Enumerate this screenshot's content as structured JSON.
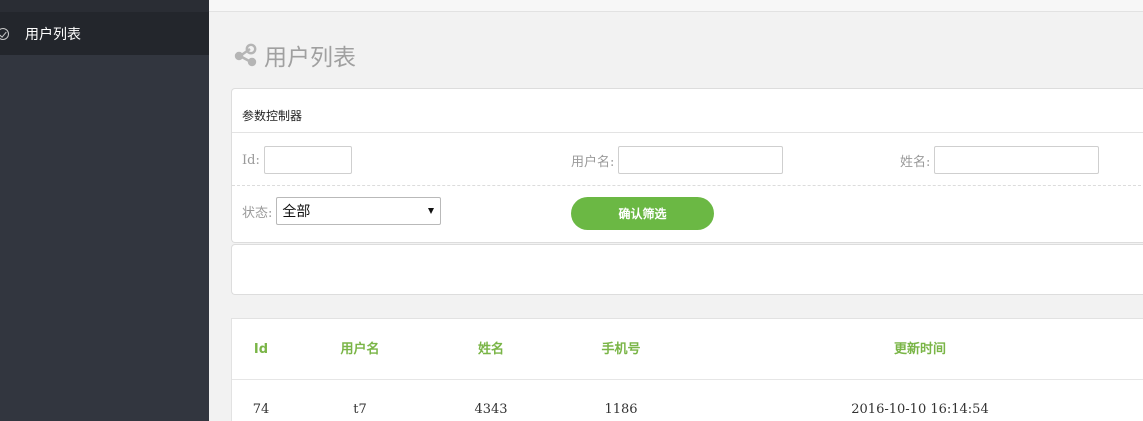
{
  "sidebar": {
    "items": [
      {
        "label": "用户列表",
        "icon": "check-circle-icon"
      }
    ]
  },
  "page": {
    "title": "用户列表",
    "title_icon": "share-nodes-icon"
  },
  "filter": {
    "panel_title": "参数控制器",
    "id_label": "Id:",
    "id_value": "",
    "username_label": "用户名:",
    "username_value": "",
    "name_label": "姓名:",
    "name_value": "",
    "status_label": "状态:",
    "status_selected": "全部",
    "confirm_label": "确认筛选",
    "accent_color": "#6bb844"
  },
  "table": {
    "columns": [
      "Id",
      "用户名",
      "姓名",
      "手机号",
      "更新时间"
    ],
    "rows": [
      [
        "74",
        "t7",
        "4343",
        "1186",
        "2016-10-10 16:14:54"
      ]
    ],
    "header_color": "#7ab547"
  }
}
